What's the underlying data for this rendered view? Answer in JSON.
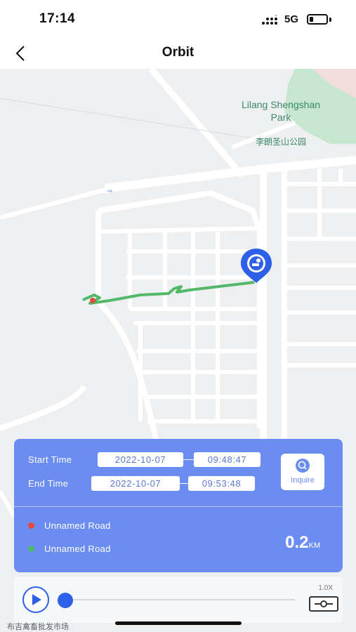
{
  "status_bar": {
    "time": "17:14",
    "network": "5G",
    "battery_level": 0.22
  },
  "nav": {
    "title": "Orbit",
    "back_icon": "chevron-left-icon"
  },
  "map": {
    "poi_name": "Lilang Shengshan Park",
    "poi_name_cn": "李朗圣山公园",
    "bottom_text": "布吉禽畜批发市场",
    "colors": {
      "background": "#eeeff1",
      "road": "#ffffff",
      "park": "#c6e6cf",
      "track": "#52b96b",
      "marker": "#2d5fe8",
      "start_dot": "#e84b3c"
    }
  },
  "panel": {
    "start_label": "Start Time",
    "start_date": "2022-10-07",
    "start_time": "09:48:47",
    "end_label": "End Time",
    "end_date": "2022-10-07",
    "end_time": "09:53:48",
    "inquire_label": "Inquire",
    "start_road": "Unnamed Road",
    "end_road": "Unnamed Road",
    "distance_value": "0.2",
    "distance_unit": "KM",
    "accent_color": "#6b8df2"
  },
  "player": {
    "speed_label": "1.0X",
    "progress": 0.0
  }
}
